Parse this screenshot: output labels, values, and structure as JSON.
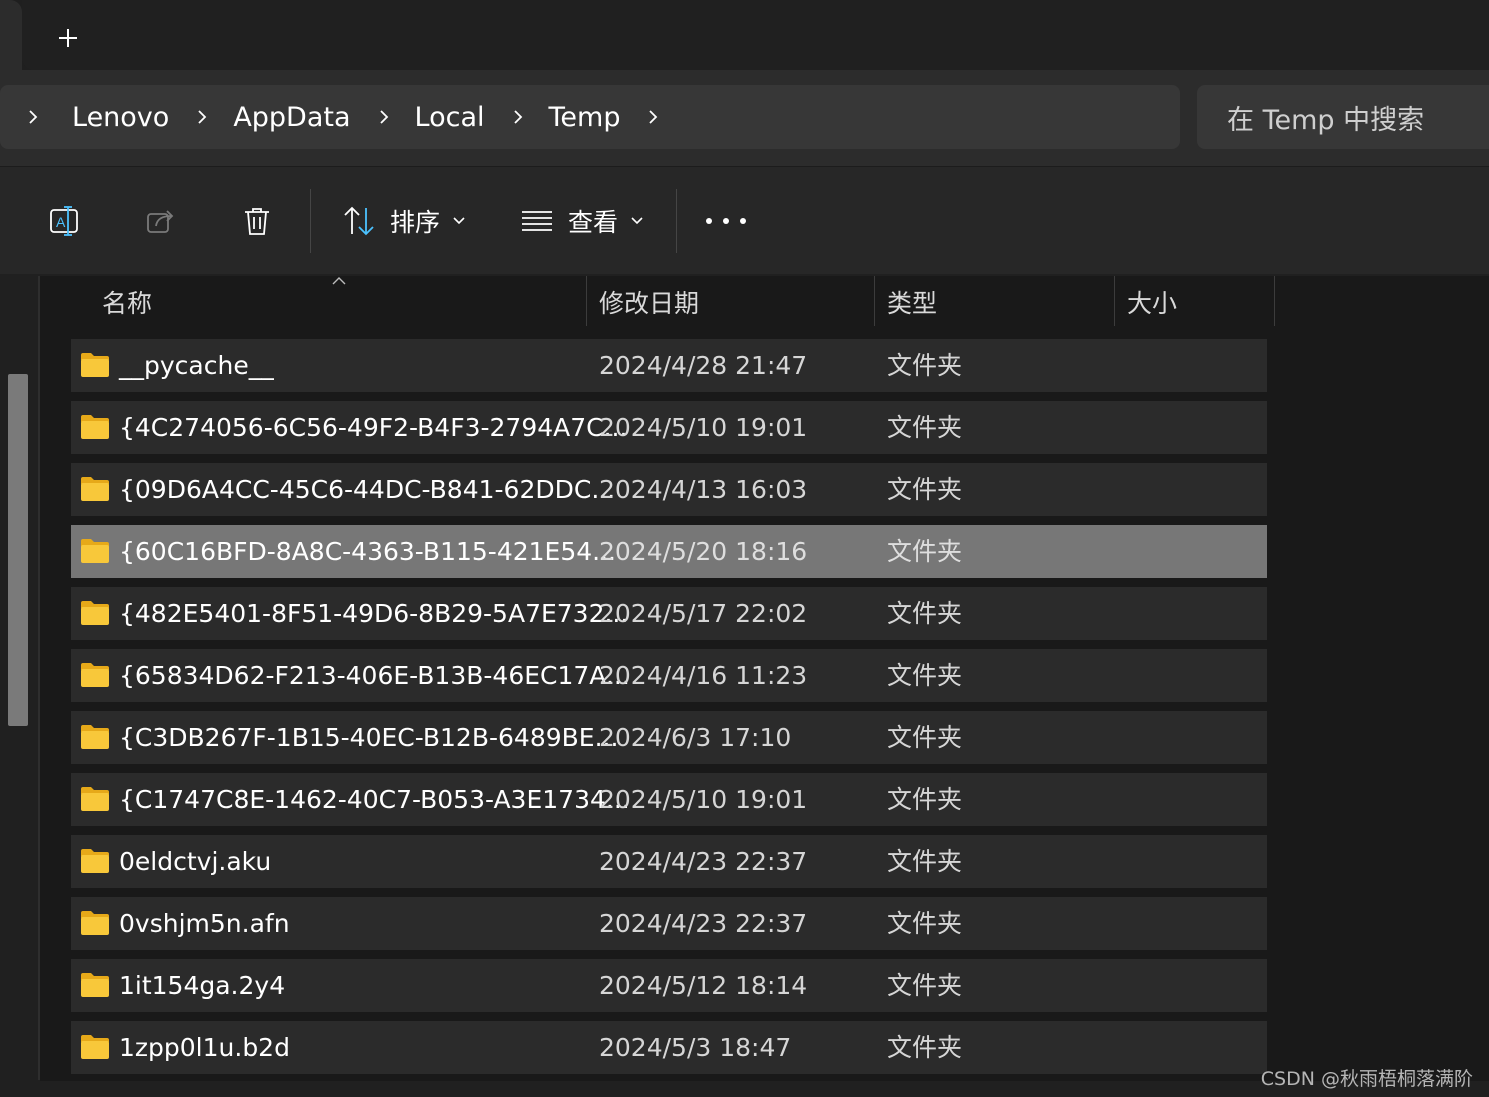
{
  "tabs": {
    "new_tab_icon": "plus-icon"
  },
  "breadcrumb": {
    "items": [
      "Lenovo",
      "AppData",
      "Local",
      "Temp"
    ]
  },
  "search": {
    "placeholder": "在 Temp 中搜索"
  },
  "toolbar": {
    "rename_icon": "rename-icon",
    "share_icon": "share-icon",
    "delete_icon": "trash-icon",
    "sort_label": "排序",
    "view_label": "查看",
    "more_icon": "more-icon"
  },
  "columns": {
    "name": "名称",
    "date": "修改日期",
    "type": "类型",
    "size": "大小"
  },
  "files": [
    {
      "name": "__pycache__",
      "date": "2024/4/28 21:47",
      "type": "文件夹",
      "selected": false
    },
    {
      "name": "{4C274056-6C56-49F2-B4F3-2794A7C...",
      "date": "2024/5/10 19:01",
      "type": "文件夹",
      "selected": false
    },
    {
      "name": "{09D6A4CC-45C6-44DC-B841-62DDC...",
      "date": "2024/4/13 16:03",
      "type": "文件夹",
      "selected": false
    },
    {
      "name": "{60C16BFD-8A8C-4363-B115-421E54...",
      "date": "2024/5/20 18:16",
      "type": "文件夹",
      "selected": true
    },
    {
      "name": "{482E5401-8F51-49D6-8B29-5A7E732...",
      "date": "2024/5/17 22:02",
      "type": "文件夹",
      "selected": false
    },
    {
      "name": "{65834D62-F213-406E-B13B-46EC17A...",
      "date": "2024/4/16 11:23",
      "type": "文件夹",
      "selected": false
    },
    {
      "name": "{C3DB267F-1B15-40EC-B12B-6489BE...",
      "date": "2024/6/3 17:10",
      "type": "文件夹",
      "selected": false
    },
    {
      "name": "{C1747C8E-1462-40C7-B053-A3E1734...",
      "date": "2024/5/10 19:01",
      "type": "文件夹",
      "selected": false
    },
    {
      "name": "0eldctvj.aku",
      "date": "2024/4/23 22:37",
      "type": "文件夹",
      "selected": false
    },
    {
      "name": "0vshjm5n.afn",
      "date": "2024/4/23 22:37",
      "type": "文件夹",
      "selected": false
    },
    {
      "name": "1it154ga.2y4",
      "date": "2024/5/12 18:14",
      "type": "文件夹",
      "selected": false
    },
    {
      "name": "1zpp0l1u.b2d",
      "date": "2024/5/3 18:47",
      "type": "文件夹",
      "selected": false
    }
  ],
  "colors": {
    "folder": "#f8c83a",
    "selected_row": "#777777",
    "row": "#2b2b2b",
    "accent": "#4cc2ff"
  },
  "watermark": "CSDN @秋雨梧桐落满阶"
}
